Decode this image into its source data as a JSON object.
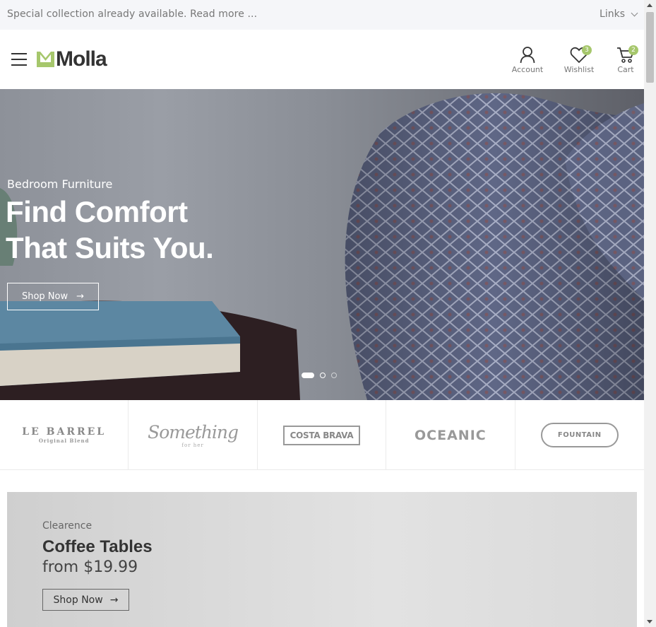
{
  "topbar": {
    "promo": "Special collection already available. Read more ...",
    "links_label": "Links"
  },
  "header": {
    "logo_text": "Molla",
    "account_label": "Account",
    "wishlist_label": "Wishlist",
    "wishlist_count": "3",
    "cart_label": "Cart",
    "cart_count": "2",
    "accent_color": "#a6c76c"
  },
  "hero": {
    "subtitle": "Bedroom Furniture",
    "headline_line1": "Find Comfort",
    "headline_line2": "That Suits You.",
    "button_label": "Shop Now",
    "button_arrow": "→",
    "slide_count": 3,
    "active_slide": 1
  },
  "brands": {
    "brand1": {
      "name": "LE BARREL",
      "tagline": "Original Blend"
    },
    "brand2": {
      "name": "Something",
      "tagline": "for her"
    },
    "brand3": {
      "name": "COSTA BRAVA"
    },
    "brand4": {
      "name": "OCEANIC"
    },
    "brand5": {
      "name": "FOUNTAIN"
    }
  },
  "banner": {
    "tag": "Clearence",
    "title": "Coffee Tables",
    "price": "from $19.99",
    "button_label": "Shop Now",
    "button_arrow": "→"
  }
}
